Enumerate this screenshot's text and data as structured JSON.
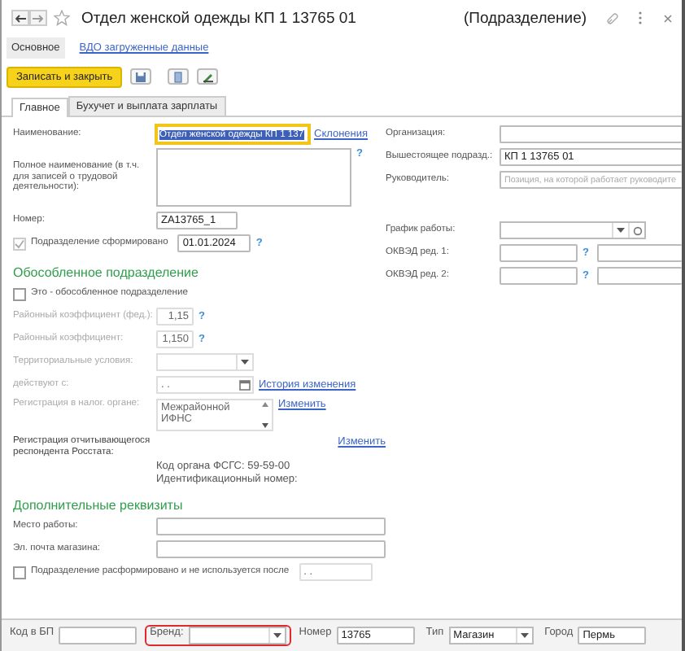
{
  "window": {
    "title": "Отдел женской одежды КП 1 13765 01",
    "type_label": "(Подразделение)"
  },
  "nav": [
    {
      "label": "Основное",
      "selected": true
    },
    {
      "label": "ВДО загруженные данные",
      "selected": false
    }
  ],
  "toolbar": {
    "primary": "Записать и закрыть"
  },
  "tabs": [
    {
      "label": "Главное",
      "selected": true
    },
    {
      "label": "Бухучет и выплата зарплаты",
      "selected": false
    }
  ],
  "left": [
    {
      "kind": "name",
      "label": "Наименование:",
      "value": "Отдел женской одежды КП 1 137",
      "focused": true,
      "link": "Склонения"
    },
    {
      "kind": "textarea",
      "label": "Полное наименование (в т.ч. для записей о трудовой деятельности):",
      "help": "?"
    },
    {
      "kind": "field",
      "label": "Номер:",
      "value": "ZA13765_1"
    },
    {
      "kind": "checkdate",
      "label": "Подразделение сформировано",
      "checked": true,
      "disabled": true,
      "value": "01.01.2024",
      "help": "?"
    },
    {
      "kind": "heading",
      "label": "Обособленное подразделение"
    },
    {
      "kind": "checkbox",
      "label": "Это - обособленное подразделение",
      "checked": false
    },
    {
      "kind": "number",
      "label": "Районный коэффициент (фед.):",
      "value": "1,15",
      "disabled": true,
      "help": "?"
    },
    {
      "kind": "number",
      "label": "Районный коэффициент:",
      "value": "1,150",
      "disabled": true,
      "help": "?"
    },
    {
      "kind": "select",
      "label": "Территориальные условия:",
      "disabled": true
    },
    {
      "kind": "date",
      "label": "действуют с:",
      "value": ". .",
      "disabled": true,
      "link": "История изменения"
    },
    {
      "kind": "multiselect",
      "label": "Регистрация в налог. органе:",
      "value": "Межрайонной ИФНС",
      "disabled": true,
      "link": "Изменить"
    },
    {
      "kind": "info",
      "label": "Регистрация отчитывающегося респондента Росстата:",
      "link": "Изменить",
      "lines": [
        "Код органа ФСГС: 59-59-00",
        "Идентификационный номер:"
      ]
    },
    {
      "kind": "heading",
      "label": "Дополнительные реквизиты"
    },
    {
      "kind": "wide",
      "label": "Место работы:"
    },
    {
      "kind": "wide",
      "label": "Эл. почта магазина:"
    },
    {
      "kind": "checkdate",
      "label": "Подразделение расформировано и не используется после",
      "checked": false,
      "disabled": false,
      "value": ". ."
    }
  ],
  "right": [
    {
      "kind": "field",
      "label": "Организация:"
    },
    {
      "kind": "field",
      "label": "Вышестоящее подразд.:",
      "value": "КП 1 13765 01"
    },
    {
      "kind": "field",
      "label": "Руководитель:",
      "placeholder": "Позиция, на которой работает руководите"
    },
    {
      "kind": "spacer"
    },
    {
      "kind": "schedule",
      "label": "График работы:"
    },
    {
      "kind": "okved",
      "label": "ОКВЭД ред. 1:",
      "help": "?"
    },
    {
      "kind": "okved",
      "label": "ОКВЭД ред. 2:",
      "help": "?"
    }
  ],
  "bottom": [
    {
      "kind": "field",
      "label": "Код в БП",
      "highlighted": false
    },
    {
      "kind": "select",
      "label": "Бренд:",
      "highlighted": true
    },
    {
      "kind": "field",
      "label": "Номер",
      "value": "13765",
      "highlighted": false
    },
    {
      "kind": "select",
      "label": "Тип",
      "value": "Магазин",
      "highlighted": false
    },
    {
      "kind": "field",
      "label": "Город",
      "value": "Пермь",
      "highlighted": false
    }
  ]
}
